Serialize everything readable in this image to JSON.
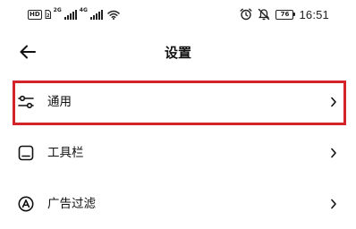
{
  "status_bar": {
    "hd_badge": "HD",
    "network_1": "2G",
    "network_2": "4G",
    "battery": "76",
    "time": "16:51"
  },
  "header": {
    "title": "设置"
  },
  "menu": [
    {
      "label": "通用",
      "icon": "sliders-icon",
      "selected": true
    },
    {
      "label": "工具栏",
      "icon": "toolbar-icon",
      "selected": false
    },
    {
      "label": "广告过滤",
      "icon": "ad-filter-icon",
      "selected": false
    }
  ],
  "colors": {
    "highlight": "#d5232a",
    "text": "#111111",
    "background": "#ffffff"
  }
}
